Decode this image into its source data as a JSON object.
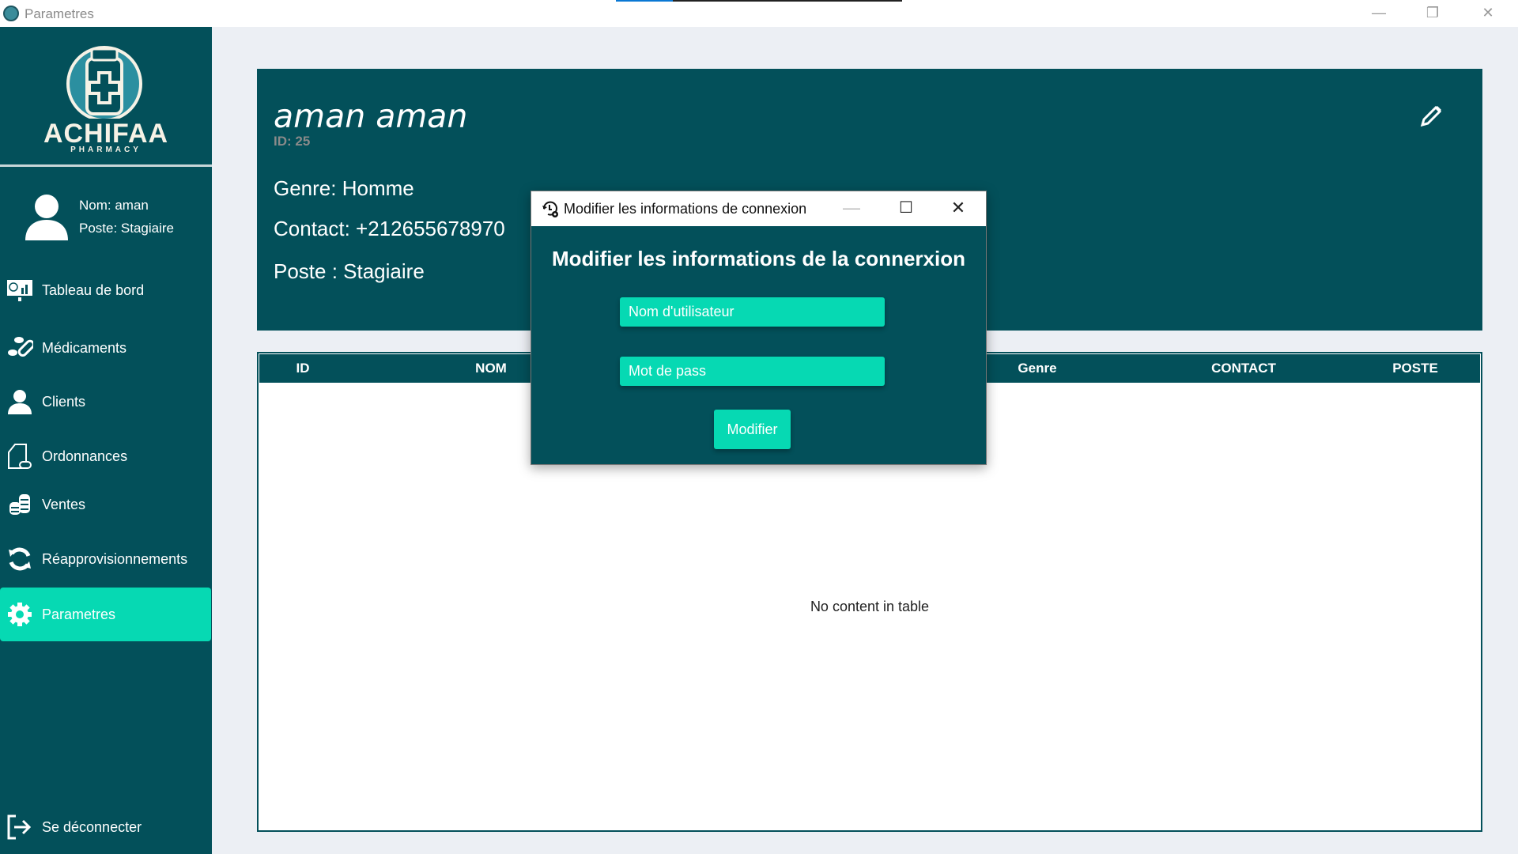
{
  "window": {
    "title": "Parametres"
  },
  "brand": {
    "name": "ACHIFAA",
    "tagline": "PHARMACY"
  },
  "profile": {
    "nom": "Nom: aman",
    "poste": "Poste: Stagiaire"
  },
  "nav": [
    {
      "label": "Tableau de bord",
      "icon": "dashboard-icon"
    },
    {
      "label": "Médicaments",
      "icon": "pills-icon"
    },
    {
      "label": "Clients",
      "icon": "user-icon"
    },
    {
      "label": "Ordonnances",
      "icon": "prescription-icon"
    },
    {
      "label": "Ventes",
      "icon": "coins-icon"
    },
    {
      "label": "Réapprovisionnements",
      "icon": "refresh-icon"
    },
    {
      "label": "Parametres",
      "icon": "gear-icon",
      "active": true
    }
  ],
  "logout": {
    "label": "Se déconnecter"
  },
  "header": {
    "name": "aman aman",
    "id": "ID: 25",
    "genre": "Genre: Homme",
    "contact": "Contact: +212655678970",
    "poste": "Poste : Stagiaire"
  },
  "table": {
    "columns": [
      "ID",
      "NOM",
      "Genre",
      "CONTACT",
      "POSTE"
    ],
    "empty": "No content in table"
  },
  "dialog": {
    "title": "Modifier les informations de connexion",
    "heading": "Modifier les informations de la connerxion",
    "username_placeholder": "Nom d'utilisateur",
    "password_placeholder": "Mot de pass",
    "submit": "Modifier"
  },
  "colors": {
    "primary": "#03505a",
    "accent": "#06d9b3",
    "background": "#eceff4"
  }
}
